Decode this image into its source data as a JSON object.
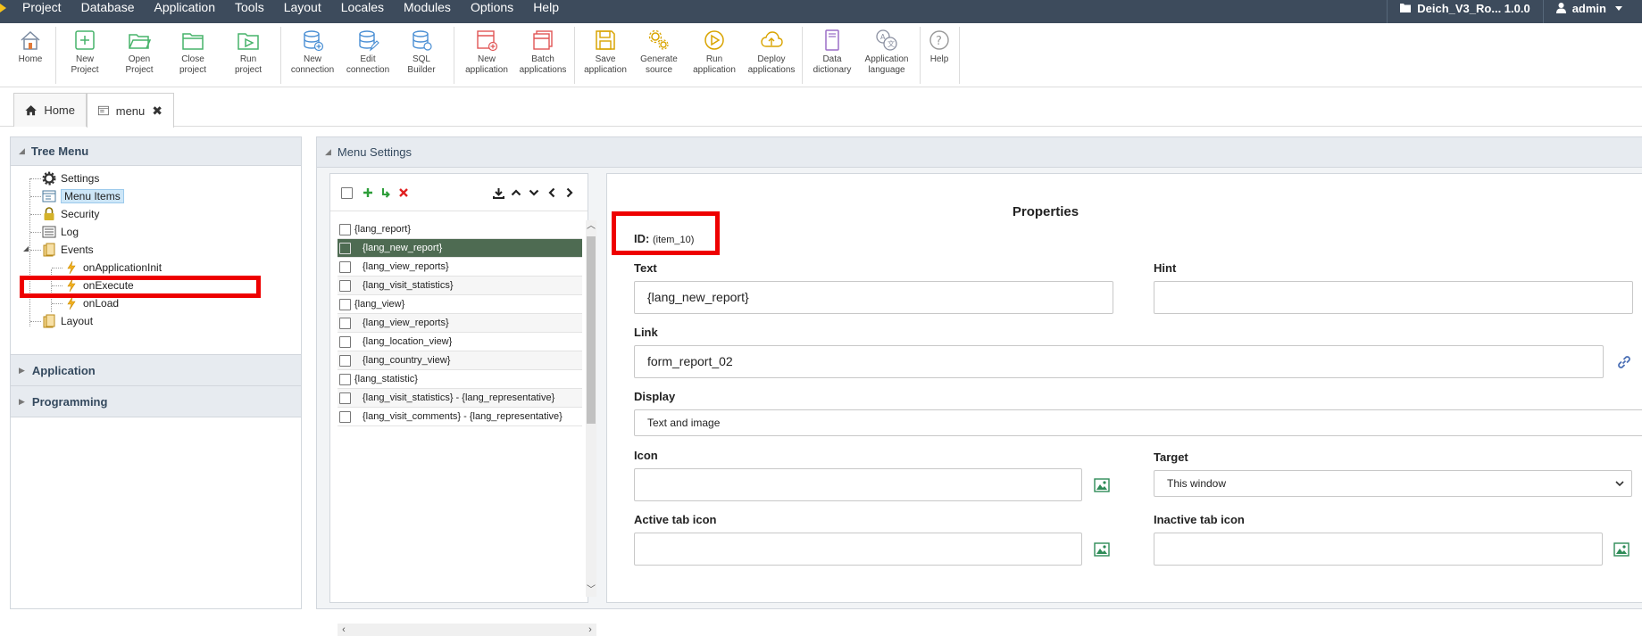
{
  "menubar": {
    "items": [
      "Project",
      "Database",
      "Application",
      "Tools",
      "Layout",
      "Locales",
      "Modules",
      "Options",
      "Help"
    ],
    "project_label": "Deich_V3_Ro... 1.0.0",
    "user_label": "admin"
  },
  "toolbar": {
    "home": [
      "Home",
      ""
    ],
    "new_project": [
      "New",
      "Project"
    ],
    "open_project": [
      "Open",
      "Project"
    ],
    "close_project": [
      "Close",
      "project"
    ],
    "run_project": [
      "Run",
      "project"
    ],
    "new_connection": [
      "New",
      "connection"
    ],
    "edit_connection": [
      "Edit",
      "connection"
    ],
    "sql_builder": [
      "SQL",
      "Builder"
    ],
    "new_application": [
      "New",
      "application"
    ],
    "batch_applications": [
      "Batch",
      "applications"
    ],
    "save_application": [
      "Save",
      "application"
    ],
    "generate_source": [
      "Generate",
      "source"
    ],
    "run_application": [
      "Run",
      "application"
    ],
    "deploy_applications": [
      "Deploy",
      "applications"
    ],
    "data_dictionary": [
      "Data",
      "dictionary"
    ],
    "application_language": [
      "Application",
      "language"
    ],
    "help": [
      "Help",
      ""
    ]
  },
  "tabs": {
    "home": "Home",
    "menu": "menu"
  },
  "left_panel": {
    "title": "Tree Menu",
    "tree": {
      "settings": "Settings",
      "menu_items": "Menu Items",
      "security": "Security",
      "log": "Log",
      "events": "Events",
      "on_application_init": "onApplicationInit",
      "on_execute": "onExecute",
      "on_load": "onLoad",
      "layout": "Layout"
    },
    "sections": {
      "application": "Application",
      "programming": "Programming"
    }
  },
  "main_panel": {
    "title": "Menu Settings",
    "items": [
      {
        "label": "{lang_report}",
        "indent": false
      },
      {
        "label": "{lang_new_report}",
        "indent": true,
        "selected": true
      },
      {
        "label": "{lang_view_reports}",
        "indent": true
      },
      {
        "label": "{lang_visit_statistics}",
        "indent": true
      },
      {
        "label": "{lang_view}",
        "indent": false
      },
      {
        "label": "{lang_view_reports}",
        "indent": true
      },
      {
        "label": "{lang_location_view}",
        "indent": true
      },
      {
        "label": "{lang_country_view}",
        "indent": true
      },
      {
        "label": "{lang_statistic}",
        "indent": false
      },
      {
        "label": "{lang_visit_statistics} - {lang_representative}",
        "indent": true
      },
      {
        "label": "{lang_visit_comments} - {lang_representative}",
        "indent": true
      }
    ]
  },
  "properties": {
    "title": "Properties",
    "id_label": "ID:",
    "id_value": "(item_10)",
    "text_label": "Text",
    "text_value": "{lang_new_report}",
    "hint_label": "Hint",
    "hint_value": "",
    "link_label": "Link",
    "link_value": "form_report_02",
    "display_label": "Display",
    "display_value": "Text and image",
    "icon_label": "Icon",
    "icon_value": "",
    "target_label": "Target",
    "target_value": "This window",
    "active_tab_icon_label": "Active tab icon",
    "active_tab_icon_value": "",
    "inactive_tab_icon_label": "Inactive tab icon",
    "inactive_tab_icon_value": ""
  },
  "colors": {
    "menubar": "#3d4b5c",
    "highlight": "#ee0000",
    "selected_row": "#4e6b52",
    "tree_selected": "#cde6f7"
  }
}
